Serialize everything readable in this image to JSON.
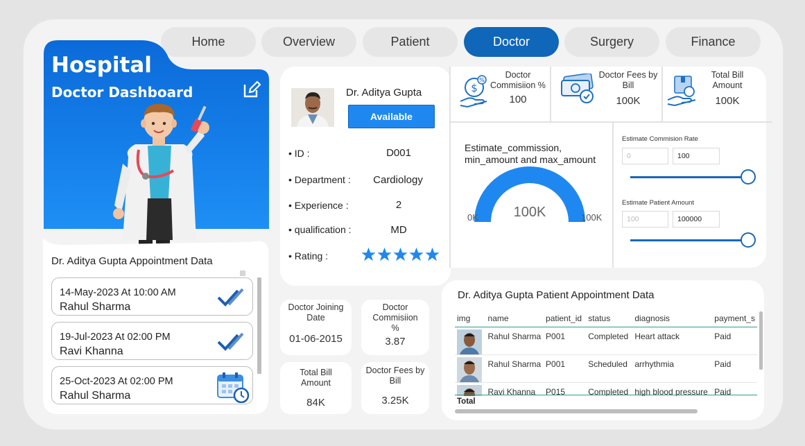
{
  "nav": {
    "tabs": [
      "Home",
      "Overview",
      "Patient",
      "Doctor",
      "Surgery",
      "Finance"
    ],
    "active": "Doctor"
  },
  "hero": {
    "title": "Hospital",
    "subtitle": "Doctor Dashboard"
  },
  "appointments": {
    "title": "Dr. Aditya Gupta Appointment Data",
    "items": [
      {
        "date": "14-May-2023 At 10:00 AM",
        "name": "Rahul Sharma",
        "icon": "double-check-icon"
      },
      {
        "date": "19-Jul-2023 At 02:00 PM",
        "name": "Ravi Khanna",
        "icon": "double-check-icon"
      },
      {
        "date": "25-Oct-2023 At 02:00 PM",
        "name": "Rahul Sharma",
        "icon": "calendar-clock-icon"
      }
    ]
  },
  "profile": {
    "name": "Dr. Aditya Gupta",
    "status": "Available",
    "fields": [
      {
        "label": "• ID :",
        "value": "D001"
      },
      {
        "label": "• Department :",
        "value": "Cardiology"
      },
      {
        "label": "• Experience :",
        "value": "2"
      },
      {
        "label": "• qualification :",
        "value": "MD"
      },
      {
        "label": "• Rating :",
        "value": ""
      }
    ],
    "rating": 5
  },
  "small_kpis": [
    {
      "label": "Doctor Joining Date",
      "value": "01-06-2015"
    },
    {
      "label": "Doctor Commisiion %",
      "value": "3.87"
    },
    {
      "label": "Total Bill Amount",
      "value": "84K"
    },
    {
      "label": "Doctor Fees by Bill",
      "value": "3.25K"
    }
  ],
  "top_kpis": [
    {
      "label": "Doctor Commisiion %",
      "value": "100",
      "icon": "money-hand-icon"
    },
    {
      "label": "Doctor Fees by Bill",
      "value": "100K",
      "icon": "cash-bills-icon"
    },
    {
      "label": "Total Bill Amount",
      "value": "100K",
      "icon": "box-hand-icon"
    }
  ],
  "gauge": {
    "title": "Estimate_commission, min_amount and max_amount",
    "min": "0K",
    "max": "100K",
    "value": "100K",
    "fraction": 1.0
  },
  "sliders": [
    {
      "label": "Estimate Commision Rate",
      "min_placeholder": "0",
      "value": "100",
      "fraction": 1.0
    },
    {
      "label": "Estimate Patient Amount",
      "min_placeholder": "100",
      "value": "100000",
      "fraction": 1.0
    }
  ],
  "patient_table": {
    "title": "Dr. Aditya Gupta Patient Appointment Data",
    "columns": [
      "img",
      "name",
      "patient_id",
      "status",
      "diagnosis",
      "payment_s"
    ],
    "rows": [
      [
        "",
        "Rahul Sharma",
        "P001",
        "Completed",
        "Heart attack",
        "Paid"
      ],
      [
        "",
        "Rahul Sharma",
        "P001",
        "Scheduled",
        "arrhythmia",
        "Paid"
      ],
      [
        "",
        "Ravi Khanna",
        "P015",
        "Completed",
        "high blood pressure",
        "Paid"
      ]
    ],
    "total_label": "Total"
  },
  "colors": {
    "accent": "#1066b8",
    "bright": "#1e88f0",
    "star": "#1e88f0"
  }
}
